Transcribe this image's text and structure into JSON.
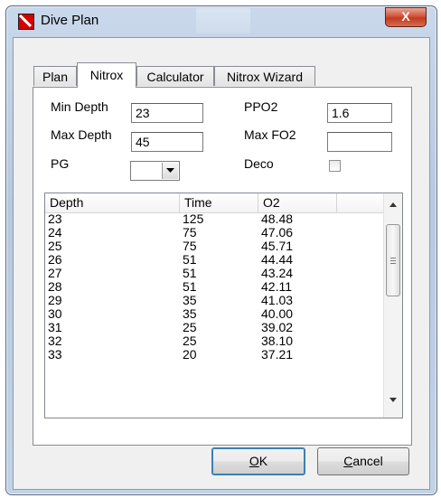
{
  "window": {
    "title": "Dive Plan",
    "close_symbol": "X",
    "icon": "app-icon"
  },
  "tabs": [
    {
      "label": "Plan",
      "active": false
    },
    {
      "label": "Nitrox",
      "active": true
    },
    {
      "label": "Calculator",
      "active": false
    },
    {
      "label": "Nitrox Wizard",
      "active": false
    }
  ],
  "form": {
    "min_depth_label": "Min Depth",
    "min_depth_value": "23",
    "max_depth_label": "Max Depth",
    "max_depth_value": "45",
    "pg_label": "PG",
    "pg_value": "",
    "ppo2_label": "PPO2",
    "ppo2_value": "1.6",
    "max_fo2_label": "Max FO2",
    "max_fo2_value": "",
    "deco_label": "Deco",
    "deco_checked": false
  },
  "table": {
    "columns": [
      "Depth",
      "Time",
      "O2",
      ""
    ],
    "rows": [
      [
        "23",
        "125",
        "48.48"
      ],
      [
        "24",
        "75",
        "47.06"
      ],
      [
        "25",
        "75",
        "45.71"
      ],
      [
        "26",
        "51",
        "44.44"
      ],
      [
        "27",
        "51",
        "43.24"
      ],
      [
        "28",
        "51",
        "42.11"
      ],
      [
        "29",
        "35",
        "41.03"
      ],
      [
        "30",
        "35",
        "40.00"
      ],
      [
        "31",
        "25",
        "39.02"
      ],
      [
        "32",
        "25",
        "38.10"
      ],
      [
        "33",
        "20",
        "37.21"
      ]
    ]
  },
  "buttons": {
    "ok_mnemonic": "O",
    "ok_rest": "K",
    "cancel_mnemonic": "C",
    "cancel_rest": "ancel"
  },
  "colors": {
    "frame": "#b7c9df",
    "close_button": "#c13a1f",
    "client_bg": "#f0f0f0"
  }
}
